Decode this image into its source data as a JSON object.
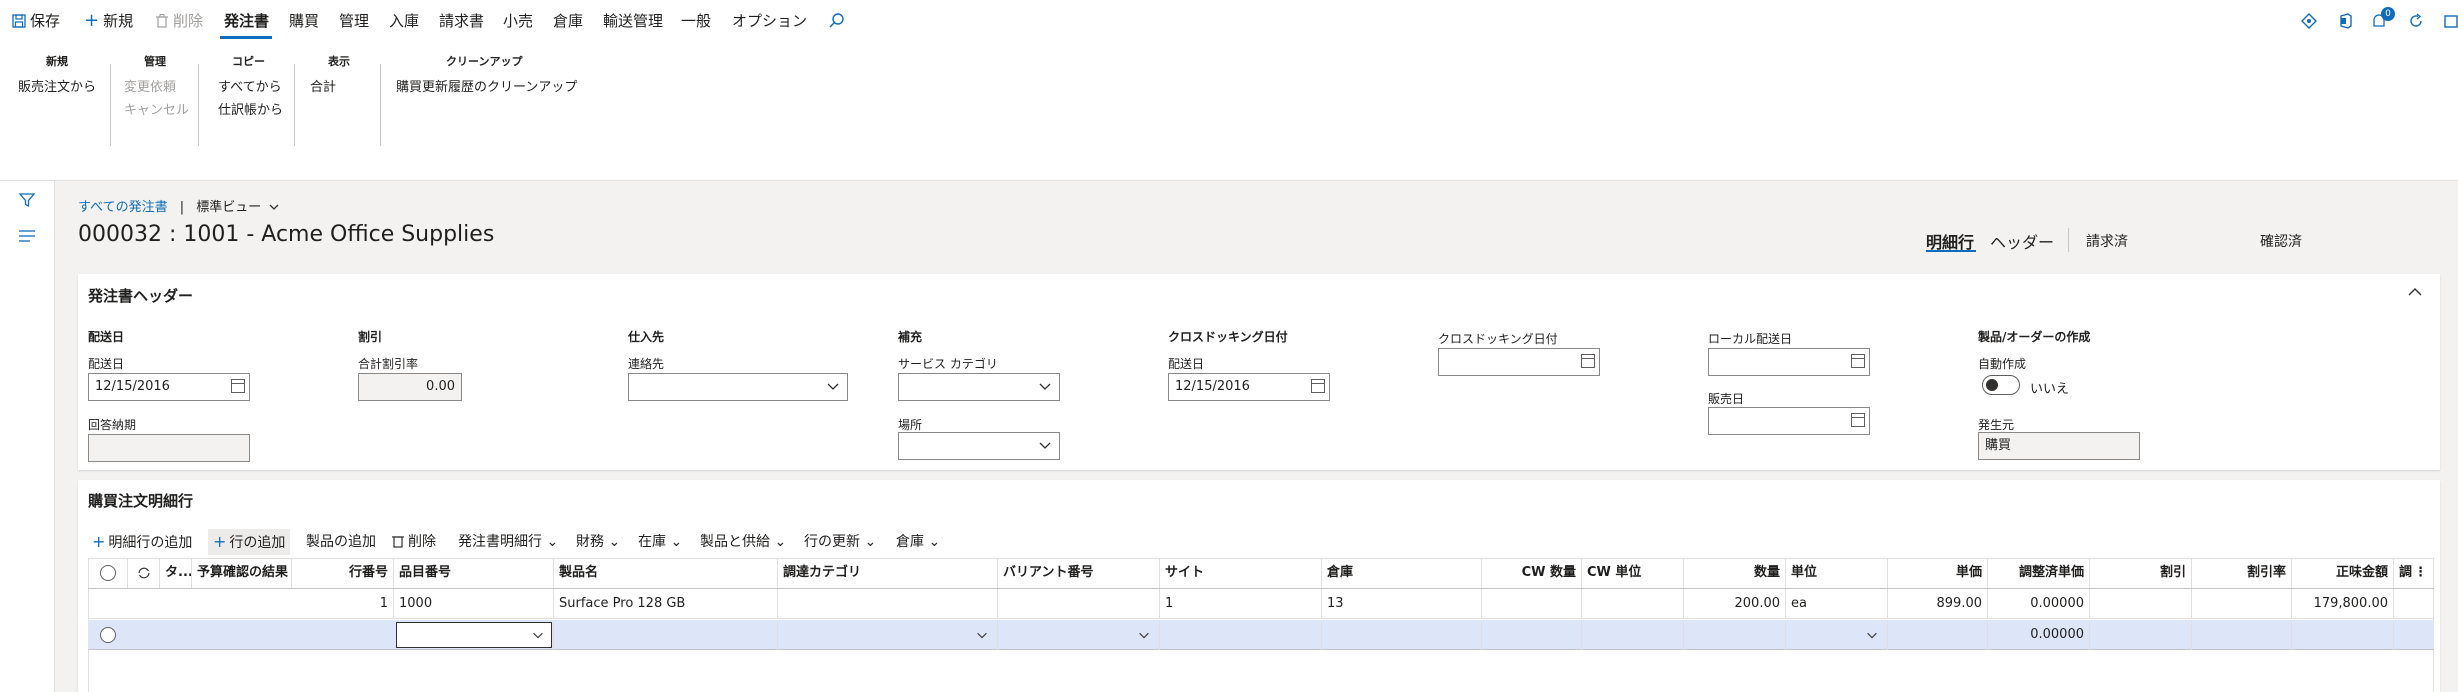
{
  "toolbar": {
    "save": "保存",
    "new": "新規",
    "delete": "削除",
    "tabs": [
      "発注書",
      "購買",
      "管理",
      "入庫",
      "請求書",
      "小売",
      "倉庫",
      "輸送管理",
      "一般",
      "オプション"
    ],
    "notification_count": "0"
  },
  "ribbon": {
    "groups": [
      {
        "title": "新規",
        "buttons": [
          "販売注文から"
        ]
      },
      {
        "title": "管理",
        "buttons": [
          "変更依頼",
          "キャンセル"
        ]
      },
      {
        "title": "コピー",
        "buttons": [
          "すべてから",
          "仕訳帳から"
        ]
      },
      {
        "title": "表示",
        "buttons": [
          "合計"
        ]
      },
      {
        "title": "クリーンアップ",
        "buttons": [
          "購買更新履歴のクリーンアップ"
        ]
      }
    ]
  },
  "breadcrumb": {
    "link": "すべての発注書",
    "separator": "|",
    "view": "標準ビュー"
  },
  "page_title": "000032 : 1001 - Acme Office Supplies",
  "view_tabs": [
    "明細行",
    "ヘッダー",
    "請求済",
    "確認済"
  ],
  "header_card": {
    "title": "発注書ヘッダー",
    "sections": {
      "delivery": {
        "title": "配送日",
        "date_label": "配送日",
        "date_value": "12/15/2016",
        "confirmed_label": "回答納期",
        "confirmed_value": ""
      },
      "discount": {
        "title": "割引",
        "label": "合計割引率",
        "value": "0.00"
      },
      "vendor": {
        "title": "仕入先",
        "label": "連絡先",
        "value": ""
      },
      "replenish": {
        "title": "補充",
        "category_label": "サービス カテゴリ",
        "category_value": "",
        "site_label": "場所",
        "site_value": ""
      },
      "crossdock": {
        "title": "クロスドッキング日付",
        "label": "配送日",
        "value": "12/15/2016"
      },
      "crossdock2": {
        "label": "クロスドッキング日付",
        "value": ""
      },
      "local": {
        "label": "ローカル配送日",
        "value": "",
        "sales_label": "販売日",
        "sales_value": ""
      },
      "product": {
        "title": "製品/オーダーの作成",
        "auto_label": "自動作成",
        "auto_value": "いいえ",
        "origin_label": "発生元",
        "origin_value": "購買"
      }
    }
  },
  "lines_card": {
    "title": "購買注文明細行",
    "toolbar": [
      "明細行の追加",
      "行の追加",
      "製品の追加",
      "削除",
      "発注書明細行",
      "財務",
      "在庫",
      "製品と供給",
      "行の更新",
      "倉庫"
    ],
    "columns": [
      "",
      "",
      "タ...",
      "予算確認の結果",
      "行番号",
      "品目番号",
      "製品名",
      "調達カテゴリ",
      "バリアント番号",
      "サイト",
      "倉庫",
      "CW 数量",
      "CW 単位",
      "数量",
      "単位",
      "単価",
      "調整済単価",
      "割引",
      "割引率",
      "正味金額",
      "調"
    ],
    "rows": [
      {
        "line": "1",
        "item": "1000",
        "name": "Surface Pro 128 GB",
        "category": "",
        "variant": "",
        "site": "1",
        "warehouse": "13",
        "cw_qty": "",
        "cw_unit": "",
        "qty": "200.00",
        "unit": "ea",
        "price": "899.00",
        "adj_price": "0.00000",
        "discount": "",
        "disc_pct": "",
        "net": "179,800.00"
      },
      {
        "line": "",
        "item": "",
        "name": "",
        "category": "",
        "variant": "",
        "site": "",
        "warehouse": "",
        "cw_qty": "",
        "cw_unit": "",
        "qty": "",
        "unit": "",
        "price": "",
        "adj_price": "0.00000",
        "discount": "",
        "disc_pct": "",
        "net": ""
      }
    ]
  },
  "colors": {
    "accent": "#0f6cbd",
    "selected_row": "#dde6f8",
    "page_bg": "#f3f2f1"
  }
}
